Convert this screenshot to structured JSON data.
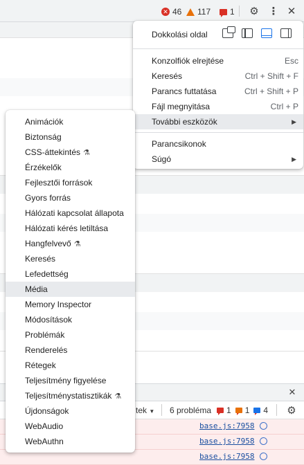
{
  "topbar": {
    "errors": "46",
    "warnings": "117",
    "issues": "1",
    "icons": [
      "error-icon",
      "warning-icon",
      "issue-icon",
      "gear-icon",
      "kebab-menu-icon",
      "close-icon"
    ]
  },
  "main_menu": {
    "dock_label": "Dokkolási oldal",
    "dock_icons": [
      "undock-icon",
      "dock-left-icon",
      "dock-bottom-icon",
      "dock-right-icon"
    ],
    "items": [
      {
        "label": "Konzolfiók elrejtése",
        "shortcut": "Esc"
      },
      {
        "label": "Keresés",
        "shortcut": "Ctrl + Shift + F"
      },
      {
        "label": "Parancs futtatása",
        "shortcut": "Ctrl + Shift + P"
      },
      {
        "label": "Fájl megnyitása",
        "shortcut": "Ctrl + P"
      },
      {
        "label": "További eszközök",
        "shortcut": ""
      },
      {
        "label": "Parancsikonok",
        "shortcut": ""
      },
      {
        "label": "Súgó",
        "shortcut": ""
      }
    ]
  },
  "sub_menu": {
    "items": [
      {
        "label": "Animációk"
      },
      {
        "label": "Biztonság"
      },
      {
        "label": "CSS-áttekintés"
      },
      {
        "label": "Érzékelők"
      },
      {
        "label": "Fejlesztői források"
      },
      {
        "label": "Gyors forrás"
      },
      {
        "label": "Hálózati kapcsolat állapota"
      },
      {
        "label": "Hálózati kérés letiltása"
      },
      {
        "label": "Hangfelvevő"
      },
      {
        "label": "Keresés"
      },
      {
        "label": "Lefedettség"
      },
      {
        "label": "Média"
      },
      {
        "label": "Memory Inspector"
      },
      {
        "label": "Módosítások"
      },
      {
        "label": "Problémák"
      },
      {
        "label": "Renderelés"
      },
      {
        "label": "Rétegek"
      },
      {
        "label": "Teljesítmény figyelése"
      },
      {
        "label": "Teljesítménystatisztikák"
      },
      {
        "label": "Újdonságok"
      },
      {
        "label": "WebAudio"
      },
      {
        "label": "WebAuthn"
      }
    ]
  },
  "console": {
    "level_fragment": "tek",
    "problems_text": "6 probléma",
    "problem_counts": [
      "1",
      "1",
      "4"
    ],
    "rows": [
      {
        "source": "base.js:7958"
      },
      {
        "source": "base.js:7958"
      },
      {
        "source": "base.js:7958"
      }
    ]
  }
}
